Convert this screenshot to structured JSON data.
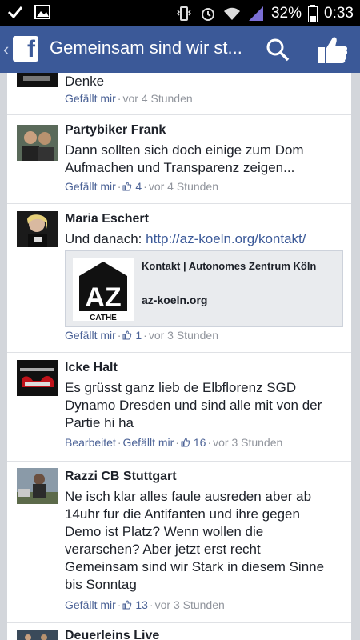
{
  "status": {
    "battery": "32%",
    "time": "0:33"
  },
  "header": {
    "title": "Gemeinsam sind wir st..."
  },
  "colors": {
    "brand": "#3b5998",
    "link": "#3b5998",
    "meta": "#90949c"
  },
  "comments": [
    {
      "name": "",
      "text": "Denke",
      "meta": {
        "like": "Gefällt mir",
        "time": "vor 4 Stunden"
      }
    },
    {
      "name": "Partybiker Frank",
      "text": "Dann sollten sich doch einige zum Dom Aufmachen und Transparenz zeigen...",
      "meta": {
        "like": "Gefällt mir",
        "count": "4",
        "time": "vor 4 Stunden"
      }
    },
    {
      "name": "Maria Eschert",
      "text_prefix": "Und danach: ",
      "link_text": "http://az-koeln.org/kontakt/",
      "card": {
        "title": "Kontakt | Autonomes Zentrum Köln",
        "domain": "az-koeln.org",
        "logo_text": "AZ",
        "logo_sub": "CATHE"
      },
      "meta": {
        "like": "Gefällt mir",
        "count": "1",
        "time": "vor 3 Stunden"
      }
    },
    {
      "name": "Icke Halt",
      "text": "Es grüsst ganz lieb de Elbflorenz SGD Dynamo Dresden und sind alle mit von der Partie hi ha",
      "meta": {
        "edited": "Bearbeitet",
        "like": "Gefällt mir",
        "count": "16",
        "time": "vor 3 Stunden"
      }
    },
    {
      "name": "Razzi CB Stuttgart",
      "text": "Ne isch klar alles faule ausreden aber ab 14uhr fur die Antifanten und ihre gegen Demo ist Platz? Wenn wollen die verarschen? Aber jetzt erst recht Gemeinsam sind wir Stark in diesem Sinne bis Sonntag",
      "meta": {
        "like": "Gefällt mir",
        "count": "13",
        "time": "vor 3 Stunden"
      }
    },
    {
      "name": "Deuerleins Live"
    }
  ]
}
